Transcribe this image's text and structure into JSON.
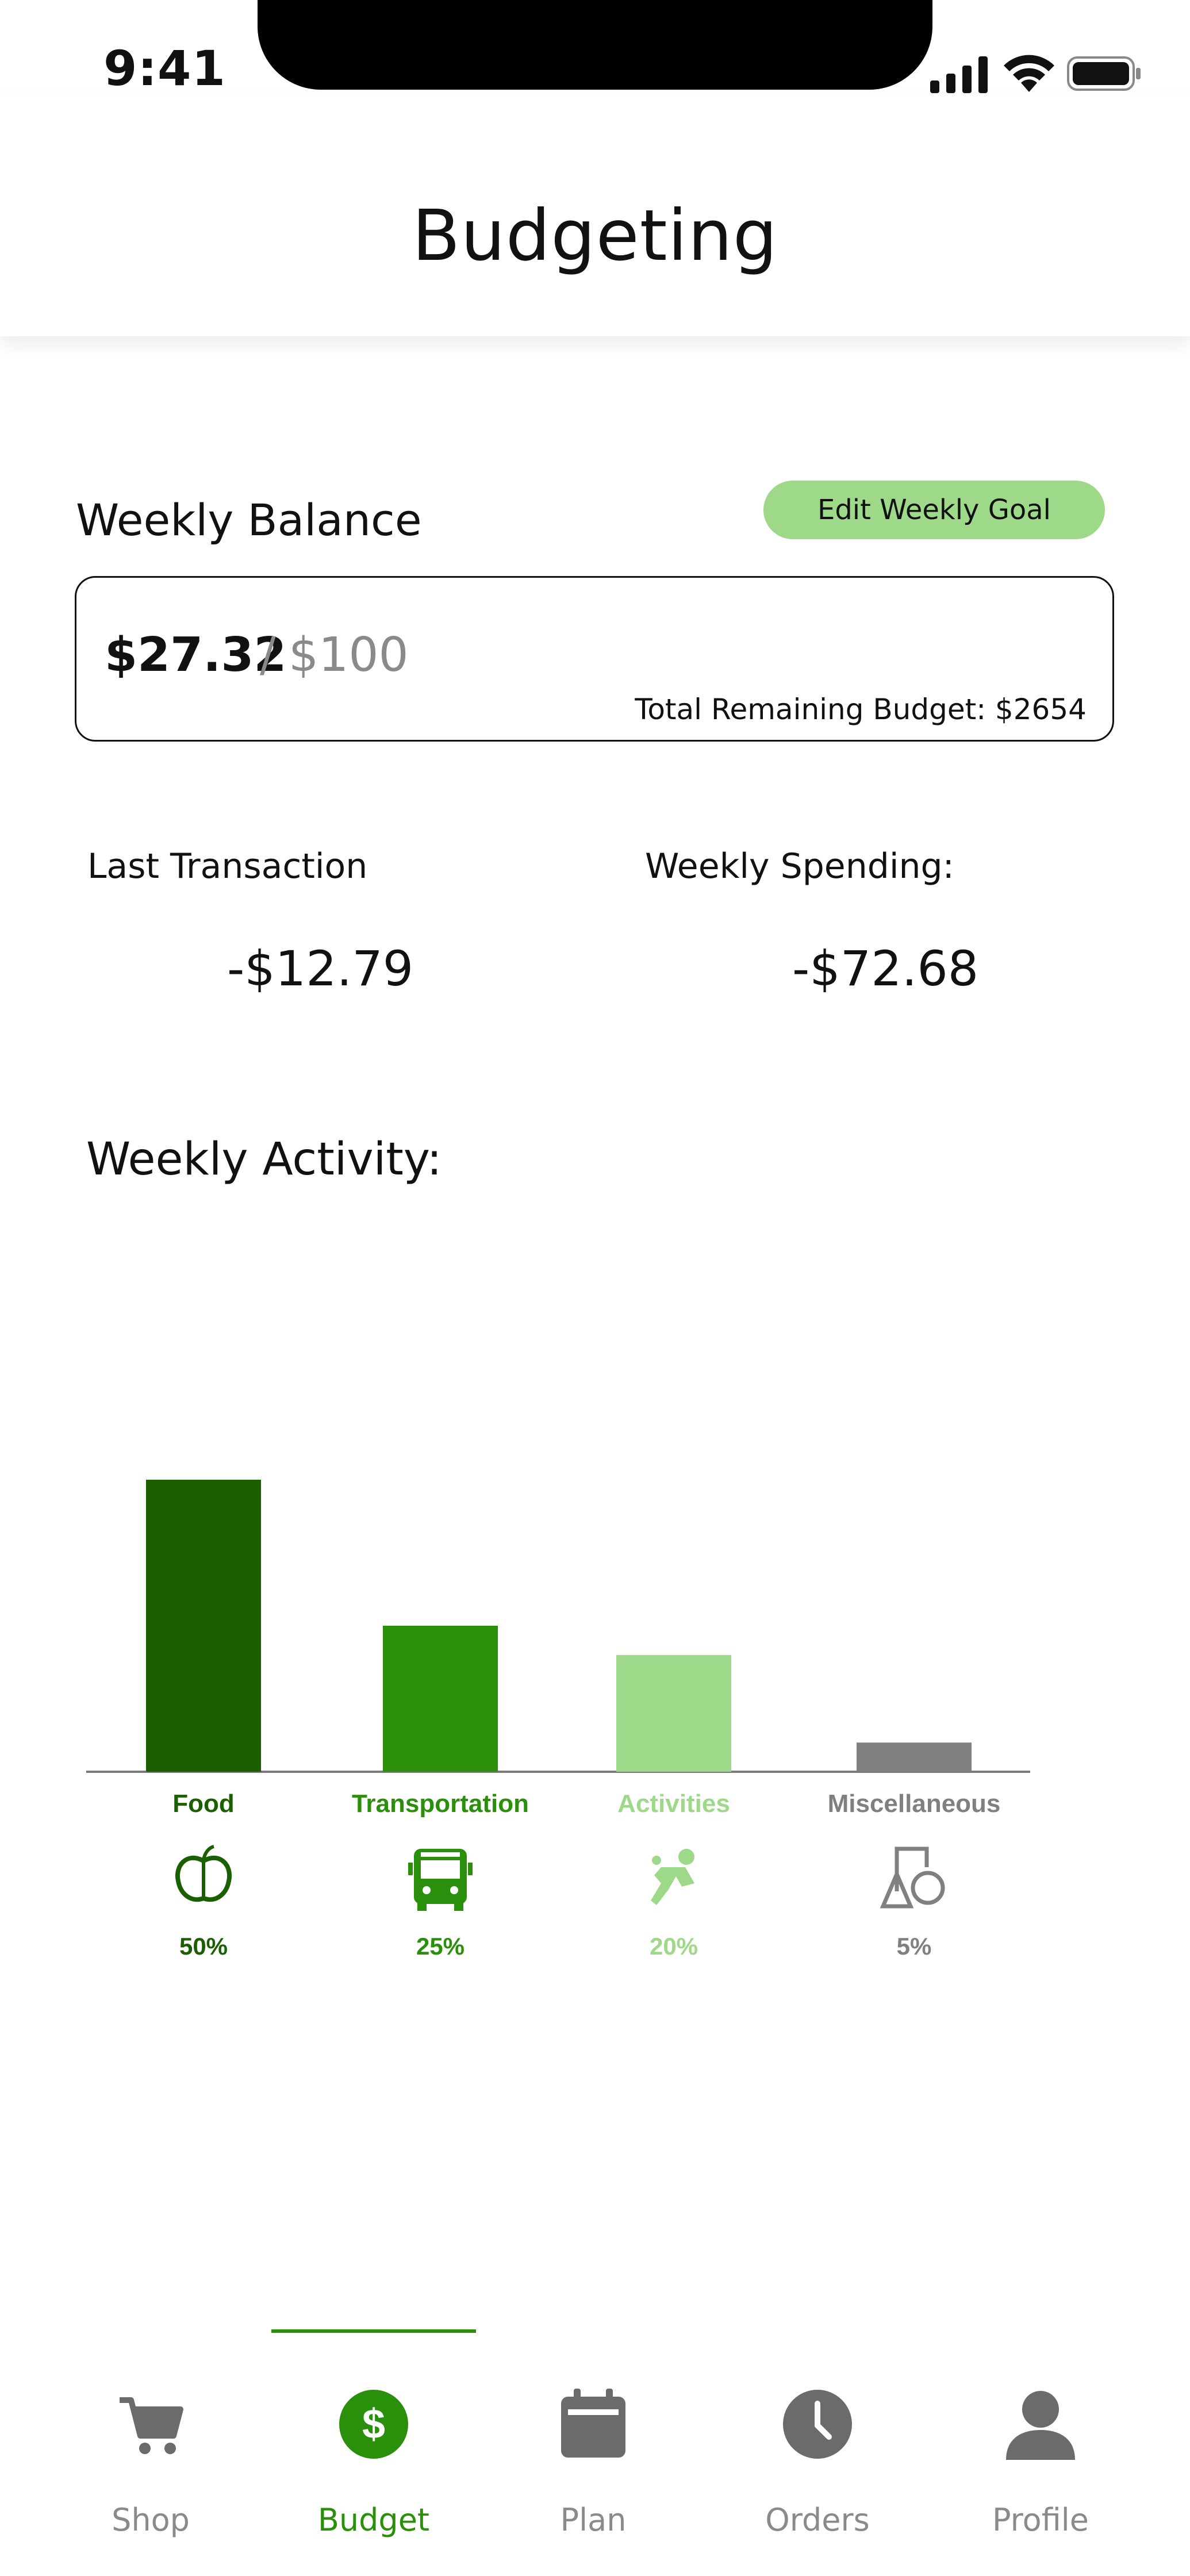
{
  "status_bar": {
    "time": "9:41"
  },
  "header": {
    "title": "Budgeting"
  },
  "balance": {
    "label": "Weekly Balance",
    "edit_goal_label": "Edit Weekly Goal",
    "current": "$27.32",
    "separator": "/",
    "goal": "$100",
    "remaining": "Total Remaining Budget: $2654"
  },
  "stats": {
    "last_transaction_label": "Last Transaction",
    "last_transaction_value": "-$12.79",
    "weekly_spending_label": "Weekly Spending:",
    "weekly_spending_value": "-$72.68"
  },
  "activity": {
    "label": "Weekly Activity:"
  },
  "chart_data": {
    "type": "bar",
    "categories": [
      "Food",
      "Transportation",
      "Activities",
      "Miscellaneous"
    ],
    "values": [
      50,
      25,
      20,
      5
    ],
    "percent_labels": [
      "50%",
      "25%",
      "20%",
      "5%"
    ],
    "colors": [
      "#1a6000",
      "#2a8f0a",
      "#9ed98a",
      "#808080"
    ],
    "icons": [
      "apple-icon",
      "bus-icon",
      "activity-icon",
      "shapes-icon"
    ],
    "grid": false
  },
  "nav": {
    "items": [
      {
        "label": "Shop",
        "icon": "cart-icon",
        "active": false
      },
      {
        "label": "Budget",
        "icon": "dollar-icon",
        "active": true
      },
      {
        "label": "Plan",
        "icon": "calendar-icon",
        "active": false
      },
      {
        "label": "Orders",
        "icon": "clock-icon",
        "active": false
      },
      {
        "label": "Profile",
        "icon": "person-icon",
        "active": false
      }
    ],
    "active_color": "#2a8f0a",
    "inactive_color": "#6b6b6b"
  }
}
